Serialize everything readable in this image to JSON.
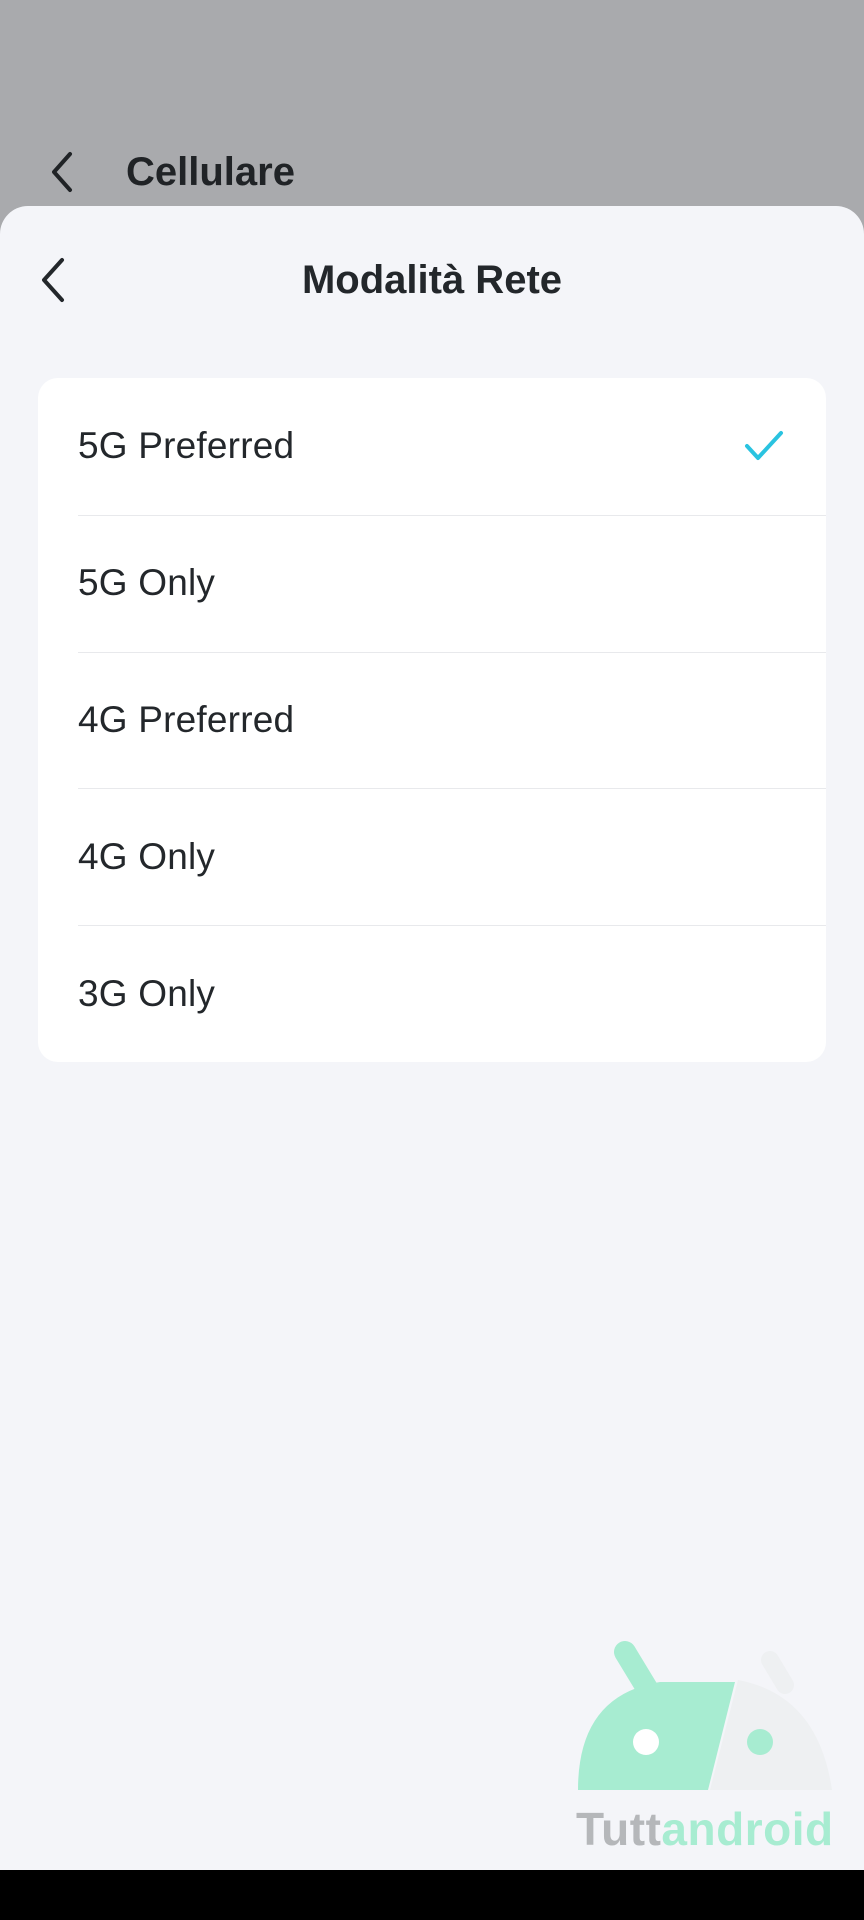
{
  "underlying_page": {
    "title": "Cellulare",
    "back_icon": "chevron-left-icon"
  },
  "sheet": {
    "title": "Modalità Rete",
    "back_icon": "chevron-left-icon"
  },
  "options": [
    {
      "label": "5G Preferred",
      "selected": true
    },
    {
      "label": "5G Only",
      "selected": false
    },
    {
      "label": "4G Preferred",
      "selected": false
    },
    {
      "label": "4G Only",
      "selected": false
    },
    {
      "label": "3G Only",
      "selected": false
    }
  ],
  "watermark": {
    "text_part1": "Tutt",
    "text_part2": "android"
  },
  "colors": {
    "accent": "#2ac3e0",
    "scrim": "#a9aaad",
    "sheet_bg": "#f4f5f9",
    "card_bg": "#ffffff",
    "text": "#23272b",
    "watermark_green": "#a7ecd1",
    "watermark_gray": "#b5b7ba"
  }
}
